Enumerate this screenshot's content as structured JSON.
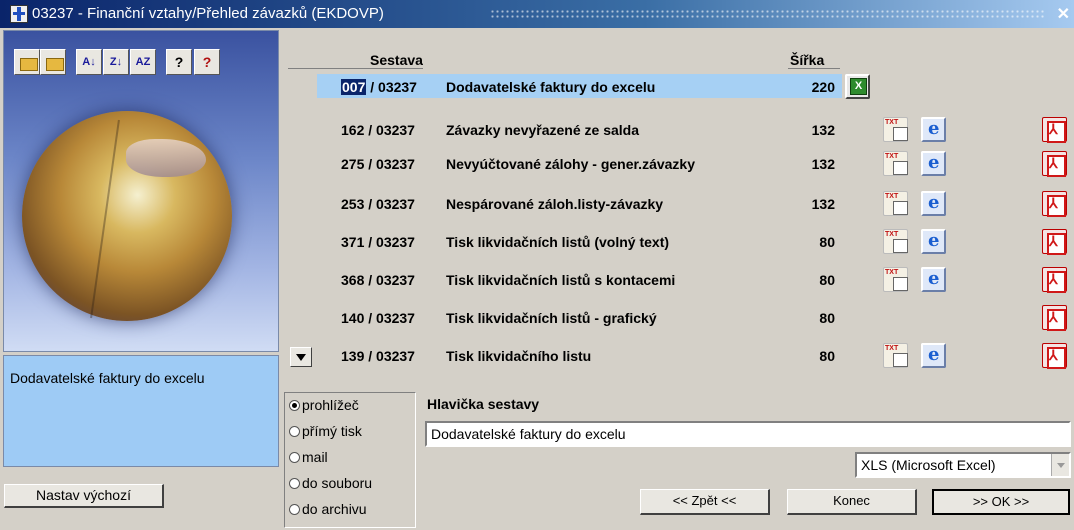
{
  "window": {
    "title": "03237 - Finanční vztahy/Přehled závazků (EKDOVP)",
    "close_glyph": "✕"
  },
  "toolbar": {
    "buttons": [
      {
        "name": "open-folder-icon",
        "glyph": ""
      },
      {
        "name": "open-folder-alt-icon",
        "glyph": ""
      },
      {
        "name": "sort-ascending-icon",
        "glyph": "A↓"
      },
      {
        "name": "sort-descending-icon",
        "glyph": "Z↓"
      },
      {
        "name": "sort-custom-icon",
        "glyph": "AZ"
      },
      {
        "name": "help-icon",
        "glyph": "?"
      },
      {
        "name": "context-help-icon",
        "glyph": "?"
      }
    ]
  },
  "list": {
    "header_sestava": "Sestava",
    "header_sirka": "Šířka",
    "rows": [
      {
        "num": "007",
        "suffix": " / 03237",
        "name": "Dodavatelské faktury do excelu",
        "width": "220",
        "selected": true,
        "xls": true,
        "txt": false,
        "ie": false,
        "pdf": false
      },
      {
        "num": "162",
        "suffix": " / 03237",
        "name": "Závazky nevyřazené ze salda",
        "width": "132",
        "txt": true,
        "ie": true,
        "pdf": true
      },
      {
        "num": "275",
        "suffix": " / 03237",
        "name": "Nevyúčtované zálohy - gener.závazky",
        "width": "132",
        "txt": true,
        "ie": true,
        "pdf": true
      },
      {
        "num": "253",
        "suffix": " / 03237",
        "name": "Nespárované záloh.listy-závazky",
        "width": "132",
        "txt": true,
        "ie": true,
        "pdf": true
      },
      {
        "num": "371",
        "suffix": " / 03237",
        "name": "Tisk likvidačních listů (volný text)",
        "width": "80",
        "txt": true,
        "ie": true,
        "pdf": true
      },
      {
        "num": "368",
        "suffix": " / 03237",
        "name": "Tisk likvidačních listů s kontacemi",
        "width": "80",
        "txt": true,
        "ie": true,
        "pdf": true
      },
      {
        "num": "140",
        "suffix": " / 03237",
        "name": "Tisk likvidačních listů - grafický",
        "width": "80",
        "txt": false,
        "ie": false,
        "pdf": true
      },
      {
        "num": "139",
        "suffix": " / 03237",
        "name": "Tisk likvidačního listu",
        "width": "80",
        "txt": true,
        "ie": true,
        "pdf": true
      }
    ]
  },
  "description": "Dodavatelské faktury do excelu",
  "default_button": "Nastav výchozí",
  "output": {
    "options": [
      "prohlížeč",
      "přímý tisk",
      "mail",
      "do souboru",
      "do archivu"
    ],
    "selected": 0
  },
  "header_section": {
    "label": "Hlavička sestavy",
    "value": "Dodavatelské faktury do excelu"
  },
  "format_select": {
    "value": "XLS (Microsoft Excel)"
  },
  "buttons": {
    "back": "<< Zpět <<",
    "end": "Konec",
    "ok": ">> OK >>"
  }
}
